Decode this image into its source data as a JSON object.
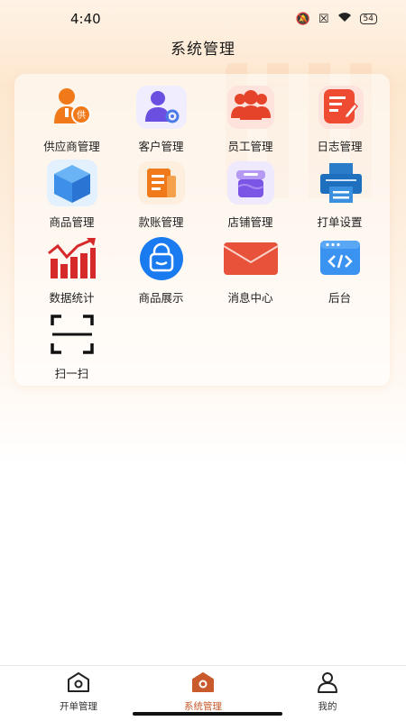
{
  "status_bar": {
    "time": "4:40",
    "battery": "54"
  },
  "header": {
    "title": "系统管理"
  },
  "menu": {
    "items": [
      {
        "label": "供应商管理",
        "icon": "supplier-icon"
      },
      {
        "label": "客户管理",
        "icon": "customer-icon"
      },
      {
        "label": "员工管理",
        "icon": "staff-icon"
      },
      {
        "label": "日志管理",
        "icon": "log-icon"
      },
      {
        "label": "商品管理",
        "icon": "product-box-icon"
      },
      {
        "label": "款账管理",
        "icon": "account-icon"
      },
      {
        "label": "店铺管理",
        "icon": "store-icon"
      },
      {
        "label": "打单设置",
        "icon": "printer-icon"
      },
      {
        "label": "数据统计",
        "icon": "stats-chart-icon"
      },
      {
        "label": "商品展示",
        "icon": "shopping-bag-icon"
      },
      {
        "label": "消息中心",
        "icon": "mail-icon"
      },
      {
        "label": "后台",
        "icon": "code-window-icon"
      },
      {
        "label": "扫一扫",
        "icon": "scan-icon"
      }
    ]
  },
  "tabbar": {
    "tabs": [
      {
        "label": "开单管理",
        "icon": "house-outline-icon"
      },
      {
        "label": "系统管理",
        "icon": "house-filled-icon"
      },
      {
        "label": "我的",
        "icon": "person-icon"
      }
    ],
    "active_color": "#c85a2c"
  }
}
